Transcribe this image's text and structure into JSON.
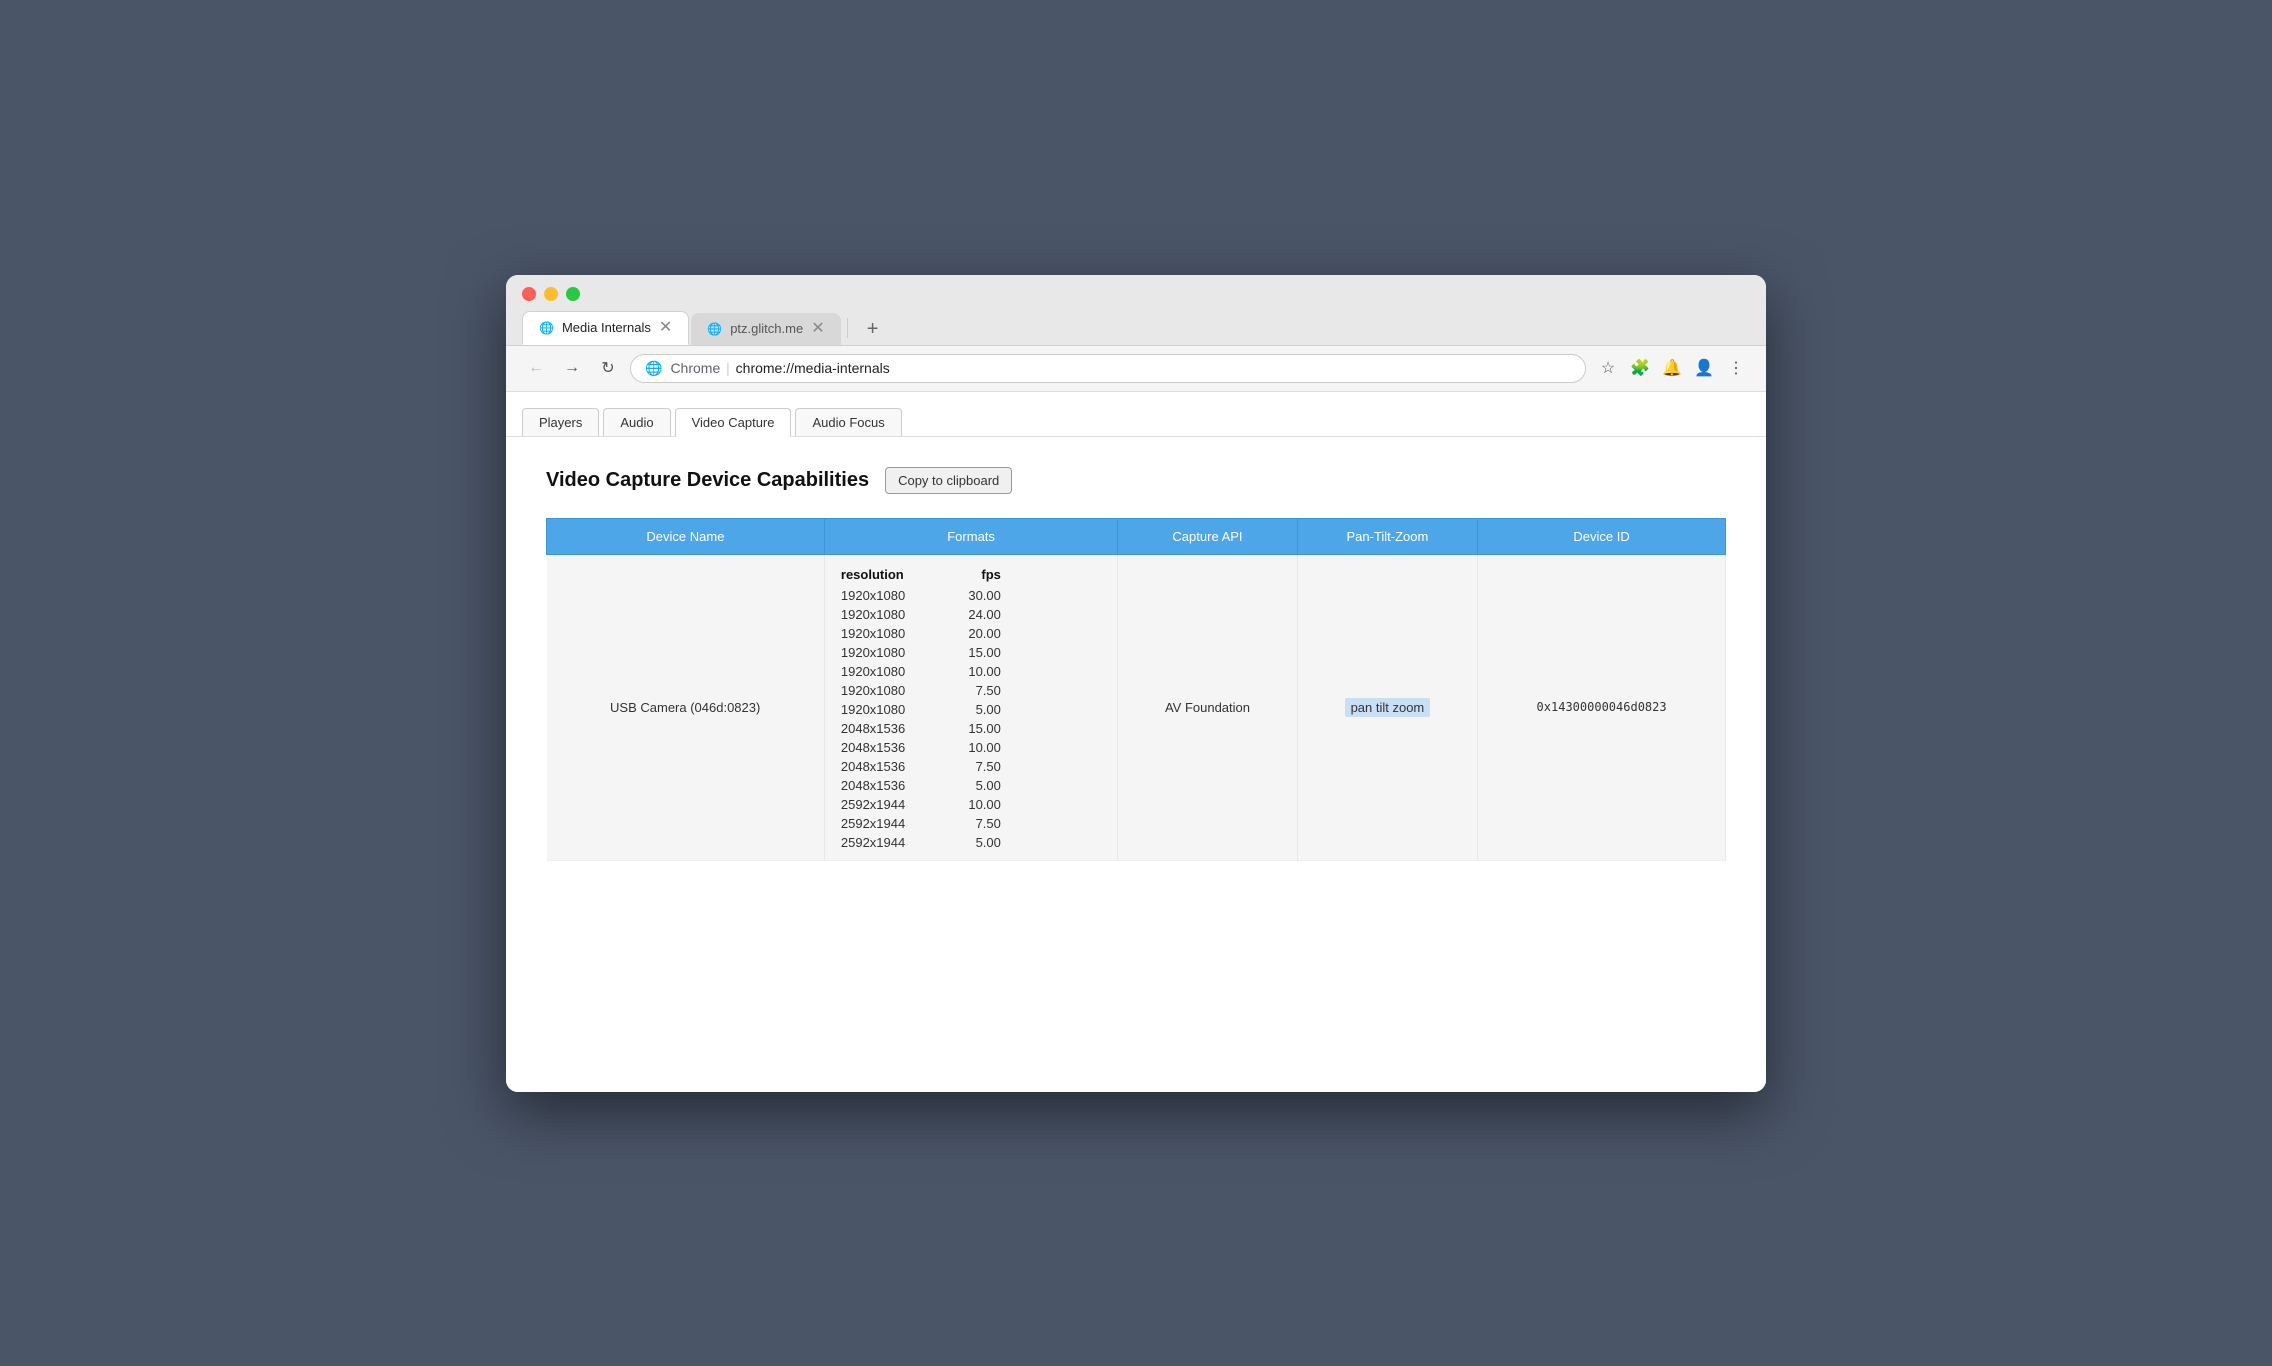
{
  "browser": {
    "tabs": [
      {
        "id": "media-internals",
        "title": "Media Internals",
        "favicon": "🌐",
        "active": true,
        "url": "chrome://media-internals"
      },
      {
        "id": "ptz-glitch",
        "title": "ptz.glitch.me",
        "favicon": "🌐",
        "active": false,
        "url": "ptz.glitch.me"
      }
    ],
    "addressBar": {
      "prefix": "Chrome",
      "separator": "|",
      "url": "chrome://media-internals"
    }
  },
  "internalsTabs": [
    {
      "id": "players",
      "label": "Players",
      "active": false
    },
    {
      "id": "audio",
      "label": "Audio",
      "active": false
    },
    {
      "id": "video-capture",
      "label": "Video Capture",
      "active": true
    },
    {
      "id": "audio-focus",
      "label": "Audio Focus",
      "active": false
    }
  ],
  "pageTitle": "Video Capture Device Capabilities",
  "copyButton": "Copy to clipboard",
  "table": {
    "headers": [
      "Device Name",
      "Formats",
      "Capture API",
      "Pan-Tilt-Zoom",
      "Device ID"
    ],
    "formatSubHeaders": {
      "resolution": "resolution",
      "fps": "fps"
    },
    "rows": [
      {
        "deviceName": "USB Camera (046d:0823)",
        "formats": [
          {
            "resolution": "1920x1080",
            "fps": "30.00"
          },
          {
            "resolution": "1920x1080",
            "fps": "24.00"
          },
          {
            "resolution": "1920x1080",
            "fps": "20.00"
          },
          {
            "resolution": "1920x1080",
            "fps": "15.00"
          },
          {
            "resolution": "1920x1080",
            "fps": "10.00"
          },
          {
            "resolution": "1920x1080",
            "fps": "7.50"
          },
          {
            "resolution": "1920x1080",
            "fps": "5.00"
          },
          {
            "resolution": "2048x1536",
            "fps": "15.00"
          },
          {
            "resolution": "2048x1536",
            "fps": "10.00"
          },
          {
            "resolution": "2048x1536",
            "fps": "7.50"
          },
          {
            "resolution": "2048x1536",
            "fps": "5.00"
          },
          {
            "resolution": "2592x1944",
            "fps": "10.00"
          },
          {
            "resolution": "2592x1944",
            "fps": "7.50"
          },
          {
            "resolution": "2592x1944",
            "fps": "5.00"
          }
        ],
        "captureAPI": "AV Foundation",
        "panTiltZoom": "pan tilt zoom",
        "deviceID": "0x14300000046d0823"
      }
    ]
  }
}
